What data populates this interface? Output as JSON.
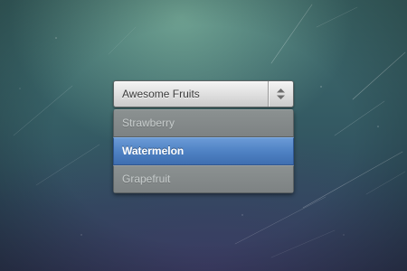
{
  "select": {
    "selected_label": "Awesome Fruits",
    "toggle_icon": "up-down-arrows-icon",
    "options": [
      {
        "label": "Strawberry",
        "selected": false
      },
      {
        "label": "Watermelon",
        "selected": true
      },
      {
        "label": "Grapefruit",
        "selected": false
      }
    ]
  },
  "colors": {
    "highlight": "#4f82c4",
    "option_background": "#858a8b",
    "header_background": "#dedede"
  }
}
